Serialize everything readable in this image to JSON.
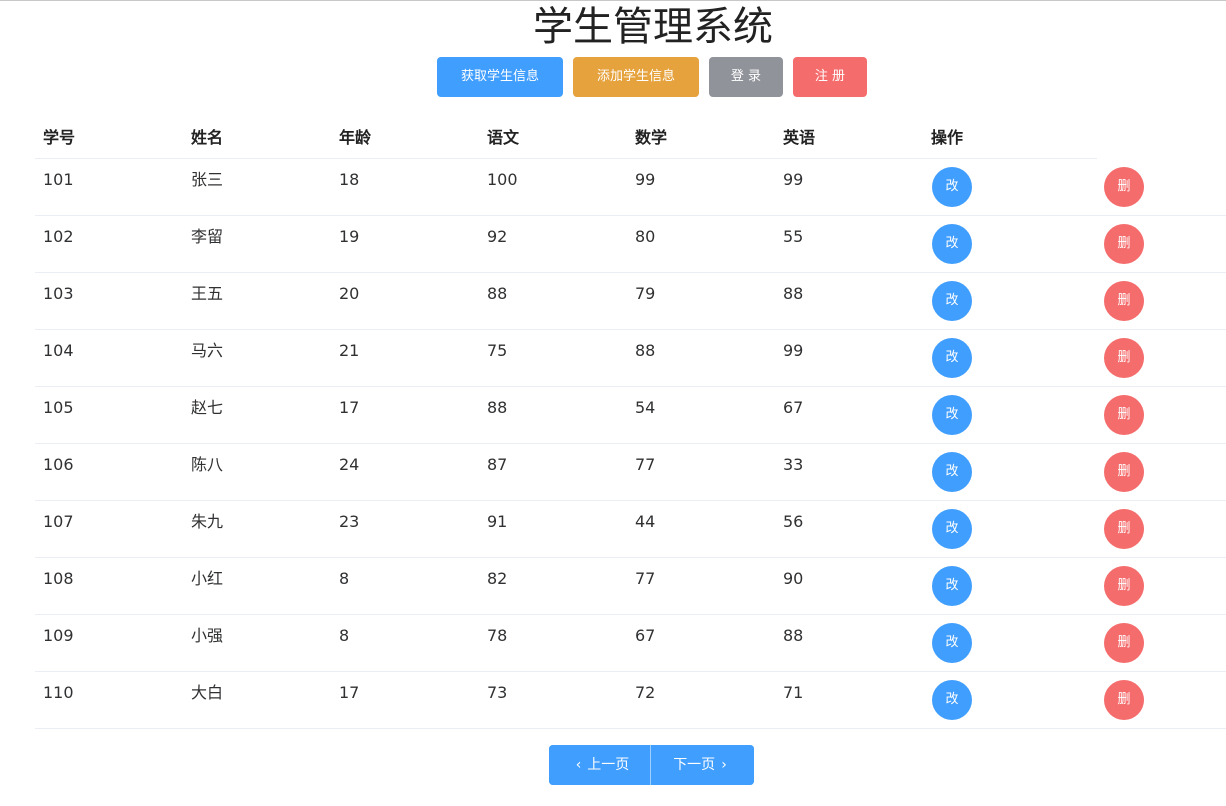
{
  "title": "学生管理系统",
  "toolbar": {
    "get_label": "获取学生信息",
    "add_label": "添加学生信息",
    "login_label": "登 录",
    "register_label": "注 册"
  },
  "table": {
    "headers": [
      "学号",
      "姓名",
      "年龄",
      "语文",
      "数学",
      "英语",
      "操作"
    ],
    "edit_label": "改",
    "delete_label": "删",
    "rows": [
      {
        "id": "101",
        "name": "张三",
        "age": "18",
        "chinese": "100",
        "math": "99",
        "english": "99"
      },
      {
        "id": "102",
        "name": "李留",
        "age": "19",
        "chinese": "92",
        "math": "80",
        "english": "55"
      },
      {
        "id": "103",
        "name": "王五",
        "age": "20",
        "chinese": "88",
        "math": "79",
        "english": "88"
      },
      {
        "id": "104",
        "name": "马六",
        "age": "21",
        "chinese": "75",
        "math": "88",
        "english": "99"
      },
      {
        "id": "105",
        "name": "赵七",
        "age": "17",
        "chinese": "88",
        "math": "54",
        "english": "67"
      },
      {
        "id": "106",
        "name": "陈八",
        "age": "24",
        "chinese": "87",
        "math": "77",
        "english": "33"
      },
      {
        "id": "107",
        "name": "朱九",
        "age": "23",
        "chinese": "91",
        "math": "44",
        "english": "56"
      },
      {
        "id": "108",
        "name": "小红",
        "age": "8",
        "chinese": "82",
        "math": "77",
        "english": "90"
      },
      {
        "id": "109",
        "name": "小强",
        "age": "8",
        "chinese": "78",
        "math": "67",
        "english": "88"
      },
      {
        "id": "110",
        "name": "大白",
        "age": "17",
        "chinese": "73",
        "math": "72",
        "english": "71"
      }
    ]
  },
  "pagination": {
    "prev_label": "上一页",
    "next_label": "下一页",
    "prev_icon": "chevron-left-icon",
    "next_icon": "chevron-right-icon"
  },
  "colors": {
    "primary": "#409eff",
    "warning": "#e6a23c",
    "info": "#909399",
    "danger": "#f56c6c"
  }
}
